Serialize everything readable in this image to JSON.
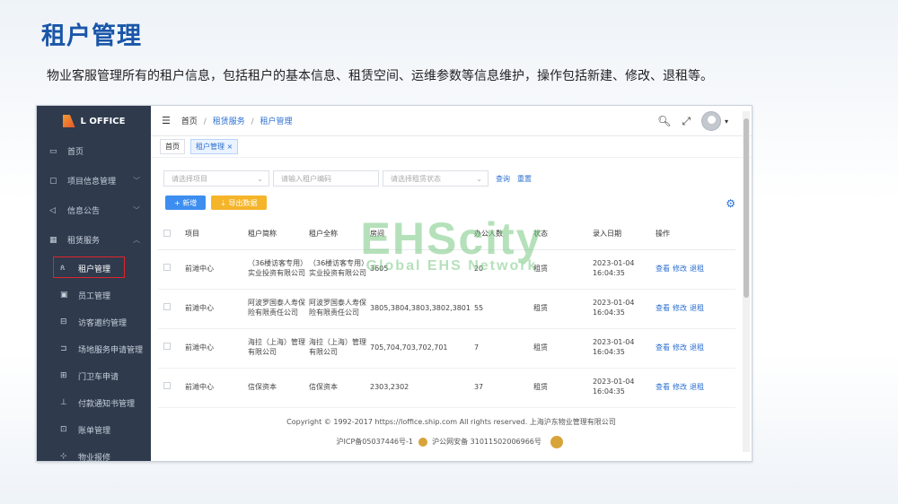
{
  "slide": {
    "title": "租户管理",
    "description": "物业客服管理所有的租户信息，包括租户的基本信息、租赁空间、运维参数等信息维护，操作包括新建、修改、退租等。"
  },
  "app": {
    "logo_text": "L OFFICE",
    "sidebar": {
      "items": [
        {
          "icon": "▭",
          "label": "首页"
        },
        {
          "icon": "▢",
          "label": "项目信息管理",
          "chevron": "﹀"
        },
        {
          "icon": "◁",
          "label": "信息公告",
          "chevron": "﹀"
        },
        {
          "icon": "▦",
          "label": "租赁服务",
          "chevron": "︿"
        }
      ],
      "sub_items": [
        {
          "icon": "ጰ",
          "label": "租户管理",
          "active": true
        },
        {
          "icon": "▣",
          "label": "员工管理"
        },
        {
          "icon": "⊟",
          "label": "访客邀约管理"
        },
        {
          "icon": "⊐",
          "label": "场地服务申请管理"
        },
        {
          "icon": "⊞",
          "label": "门卫车申请"
        },
        {
          "icon": "⊥",
          "label": "付款通知书管理"
        },
        {
          "icon": "⊡",
          "label": "账单管理"
        },
        {
          "icon": "⊹",
          "label": "物业报修"
        }
      ]
    },
    "breadcrumb": {
      "home": "首页",
      "sep": "/",
      "level1": "租赁服务",
      "level2": "租户管理"
    },
    "tabs": [
      {
        "label": "首页"
      },
      {
        "label": "租户管理 ×",
        "active": true
      }
    ],
    "filters": {
      "project_placeholder": "请选择项目",
      "tenant_placeholder": "请输入租户编码",
      "status_placeholder": "请选择租赁状态",
      "search_label": "查询",
      "reset_label": "重置"
    },
    "buttons": {
      "add": "+ 新增",
      "export": "⇣ 导出数据"
    },
    "table": {
      "headers": [
        "项目",
        "租户简称",
        "租户全称",
        "房间",
        "办公人数",
        "状态",
        "录入日期",
        "操作"
      ],
      "rows": [
        {
          "project": "前滩中心",
          "short": "（36楼访客专用）实业投资有限公司",
          "full": "（36楼访客专用）实业投资有限公司",
          "room": "3605",
          "people": "20",
          "status": "租赁",
          "date": "2023-01-04 16:04:35"
        },
        {
          "project": "前滩中心",
          "short": "阿波罗国泰人寿保险有限责任公司",
          "full": "阿波罗国泰人寿保险有限责任公司",
          "room": "3805,3804,3803,3802,3801",
          "people": "55",
          "status": "租赁",
          "date": "2023-01-04 16:04:35"
        },
        {
          "project": "前滩中心",
          "short": "海拉（上海）管理有限公司",
          "full": "海拉（上海）管理有限公司",
          "room": "705,704,703,702,701",
          "people": "7",
          "status": "租赁",
          "date": "2023-01-04 16:04:35"
        },
        {
          "project": "前滩中心",
          "short": "信保资本",
          "full": "信保资本",
          "room": "2303,2302",
          "people": "37",
          "status": "租赁",
          "date": "2023-01-04 16:04:35"
        }
      ],
      "ops": {
        "view": "查看",
        "edit": "修改",
        "terminate": "退租"
      }
    },
    "footer": {
      "copyright": "Copyright © 1992-2017 https://loffice.ship.com All rights reserved. 上海沪东物业管理有限公司",
      "icp": "沪ICP备05037446号-1",
      "police": "沪公网安备 31011502006966号"
    }
  },
  "watermark": {
    "big": "EHScity",
    "small": "Global EHS Network"
  }
}
